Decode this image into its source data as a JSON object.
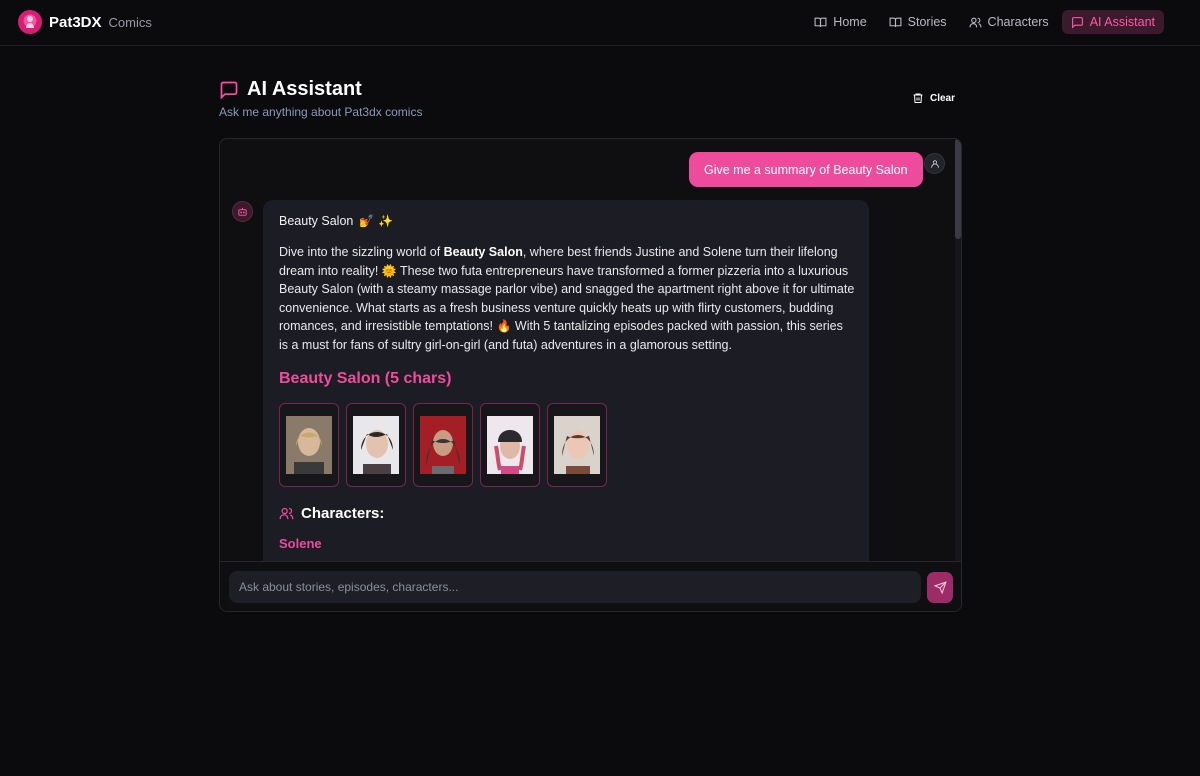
{
  "header": {
    "brand_name": "Pat3DX",
    "brand_sub": "Comics",
    "nav": [
      {
        "label": "Home",
        "icon": "book-open-icon"
      },
      {
        "label": "Stories",
        "icon": "book-open-icon"
      },
      {
        "label": "Characters",
        "icon": "users-icon"
      },
      {
        "label": "AI Assistant",
        "icon": "message-square-icon",
        "active": true
      }
    ]
  },
  "page": {
    "title": "AI Assistant",
    "subtitle": "Ask me anything about Pat3dx comics",
    "clear_label": "Clear"
  },
  "chat": {
    "user_message": "Give me a summary of Beauty Salon",
    "bot": {
      "heading": "Beauty Salon",
      "heading_emojis": "💅 ✨",
      "para_intro": "Dive into the sizzling world of ",
      "para_bold": "Beauty Salon",
      "para_part1": ", where best friends Justine and Solene turn their lifelong dream into reality! ",
      "emoji_sun": "🌞",
      "para_part2": " These two futa entrepreneurs have transformed a former pizzeria into a luxurious Beauty Salon (with a steamy massage parlor vibe) and snagged the apartment right above it for ultimate convenience. What starts as a fresh business venture quickly heats up with flirty customers, budding romances, and irresistible temptations! ",
      "emoji_fire": "🔥",
      "para_part3": " With 5 tantalizing episodes packed with passion, this series is a must for fans of sultry girl-on-girl (and futa) adventures in a glamorous setting.",
      "section_title": "Beauty Salon (5 chars)",
      "characters_heading": "Characters:",
      "first_character": "Solene"
    },
    "input_placeholder": "Ask about stories, episodes, characters..."
  },
  "colors": {
    "accent": "#ef4b9d",
    "background": "#0b0b0e",
    "bubble_bot": "#1c1d24"
  }
}
